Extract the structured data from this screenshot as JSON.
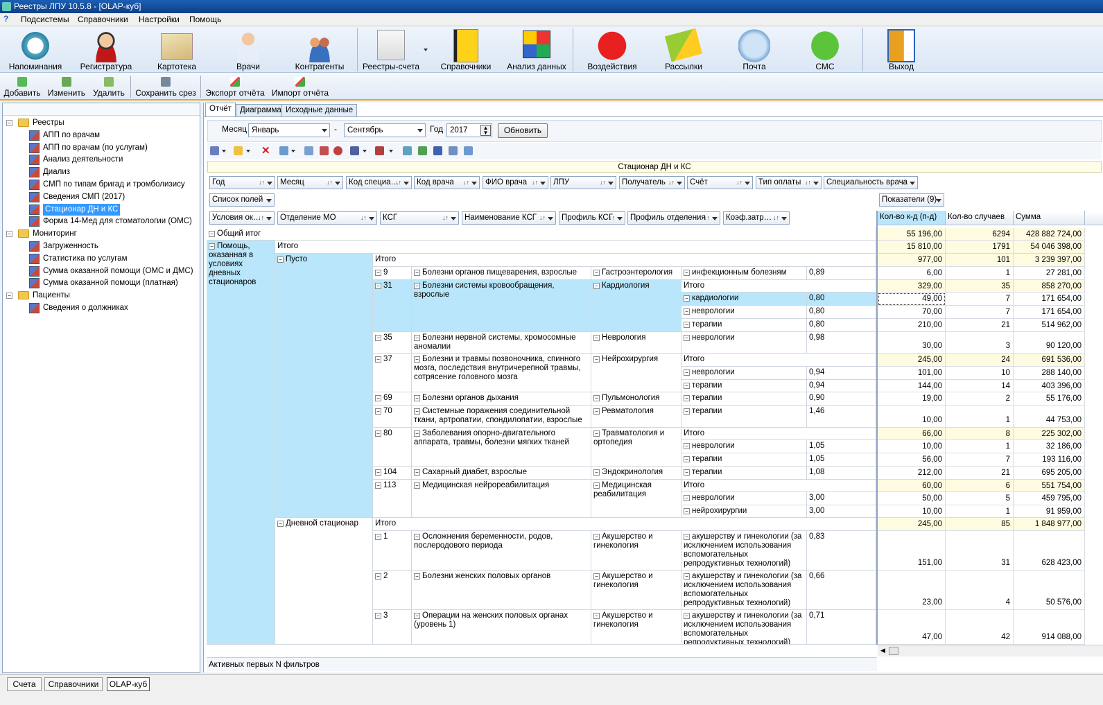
{
  "window": {
    "title": "Реестры ЛПУ 10.5.8 - [OLAP-куб]"
  },
  "menu": [
    "Подсистемы",
    "Справочники",
    "Настройки",
    "Помощь"
  ],
  "ribbon": [
    {
      "label": "Напоминания",
      "icon": "alarm-clock-icon"
    },
    {
      "label": "Регистратура",
      "icon": "receptionist-icon"
    },
    {
      "label": "Картотека",
      "icon": "card-index-icon"
    },
    {
      "label": "Врачи",
      "icon": "doctor-icon"
    },
    {
      "label": "Контрагенты",
      "icon": "people-icon"
    },
    {
      "label": "Реестры-счета",
      "icon": "invoice-icon"
    },
    {
      "label": "Справочники",
      "icon": "book-icon"
    },
    {
      "label": "Анализ данных",
      "icon": "rubik-cube-icon"
    },
    {
      "label": "Воздействия",
      "icon": "sale-tag-icon"
    },
    {
      "label": "Рассылки",
      "icon": "envelopes-icon"
    },
    {
      "label": "Почта",
      "icon": "mail-icon"
    },
    {
      "label": "СМС",
      "icon": "sms-icon"
    },
    {
      "label": "Выход",
      "icon": "exit-door-icon"
    }
  ],
  "toolbar": [
    "Добавить",
    "Изменить",
    "Удалить",
    "Сохранить срез",
    "Экспорт отчёта",
    "Импорт отчёта"
  ],
  "tree": [
    {
      "label": "Реестры",
      "type": "folder"
    },
    {
      "label": "АПП по врачам",
      "type": "cube"
    },
    {
      "label": "АПП по врачам (по услугам)",
      "type": "cube"
    },
    {
      "label": "Анализ деятельности",
      "type": "cube"
    },
    {
      "label": "Диализ",
      "type": "cube"
    },
    {
      "label": "СМП по типам бригад и тромболизису",
      "type": "cube"
    },
    {
      "label": "Сведения СМП (2017)",
      "type": "cube"
    },
    {
      "label": "Стационар ДН и КС",
      "type": "cube",
      "selected": true
    },
    {
      "label": "Форма 14-Мед для стоматологии (ОМС)",
      "type": "cube"
    },
    {
      "label": "Мониторинг",
      "type": "folder"
    },
    {
      "label": "Загруженность",
      "type": "cube"
    },
    {
      "label": "Статистика по услугам",
      "type": "cube"
    },
    {
      "label": "Сумма оказанной помощи (ОМС и ДМС)",
      "type": "cube"
    },
    {
      "label": "Сумма оказанной помощи (платная)",
      "type": "cube"
    },
    {
      "label": "Пациенты",
      "type": "folder"
    },
    {
      "label": "Сведения о должниках",
      "type": "cube"
    }
  ],
  "tabs": [
    "Отчёт",
    "Диаграмма",
    "Исходные данные"
  ],
  "filter": {
    "month_label": "Месяц",
    "month_from": "Январь",
    "dash": "-",
    "month_to": "Сентябрь",
    "year_label": "Год",
    "year": "2017",
    "refresh": "Обновить"
  },
  "report_title": "Стационар ДН и КС",
  "filter_fields": [
    "Год",
    "Месяц",
    "Код специа…",
    "Код врача",
    "ФИО врача",
    "ЛПУ",
    "Получатель",
    "Счёт",
    "Тип оплаты",
    "Специальность врача"
  ],
  "fields_list": "Список полей",
  "row_fields": [
    "Условия ок…",
    "Отделение МО",
    "КСГ",
    "Наименование КСГ",
    "Профиль КСГ",
    "Профиль отделения",
    "Коэф.затр…"
  ],
  "measures_button": "Показатели (9)",
  "measures": [
    "Кол-во к-д (п-д)",
    "Кол-во случаев",
    "Сумма"
  ],
  "grid_text": {
    "grand_total": "Общий итог",
    "cond": "Помощь, оказанная в условиях дневных стационаров",
    "total": "Итого",
    "empty": "Пусто",
    "day_hosp": "Дневной стационар",
    "r9": [
      "9",
      "Болезни органов пищеварения, взрослые",
      "Гастроэнтерология",
      "инфекционным болезням",
      "0,89"
    ],
    "r31": [
      "31",
      "Болезни системы кровообращения, взрослые",
      "Кардиология",
      "кардиологии",
      "0,80",
      "неврологии",
      "0,80",
      "терапии",
      "0,80"
    ],
    "r35": [
      "35",
      "Болезни нервной системы, хромосомные аномалии",
      "Неврология",
      "неврологии",
      "0,98"
    ],
    "r37": [
      "37",
      "Болезни и травмы позвоночника, спинного мозга, последствия внутричерепной травмы, сотрясение головного мозга",
      "Нейрохирургия",
      "неврологии",
      "0,94",
      "терапии",
      "0,94"
    ],
    "r69": [
      "69",
      "Болезни органов дыхания",
      "Пульмонология",
      "терапии",
      "0,90"
    ],
    "r70": [
      "70",
      "Системные поражения соединительной ткани, артропатии, спондилопатии, взрослые",
      "Ревматология",
      "терапии",
      "1,46"
    ],
    "r80": [
      "80",
      "Заболевания опорно-двигательного аппарата, травмы, болезни мягких тканей",
      "Травматология и ортопедия",
      "неврологии",
      "1,05",
      "терапии",
      "1,05"
    ],
    "r104": [
      "104",
      "Сахарный диабет, взрослые",
      "Эндокринология",
      "терапии",
      "1,08"
    ],
    "r113": [
      "113",
      "Медицинская нейрореабилитация",
      "Медицинская реабилитация",
      "неврологии",
      "3,00",
      "нейрохирургии",
      "3,00"
    ],
    "r1": [
      "1",
      "Осложнения беременности, родов, послеродового периода",
      "Акушерство и гинекология",
      "акушерству и гинекологии (за исключением использования вспомогательных репродуктивных технологий)",
      "0,83"
    ],
    "r2": [
      "2",
      "Болезни женских половых органов",
      "Акушерство и гинекология",
      "акушерству и гинекологии (за исключением использования вспомогательных репродуктивных технологий)",
      "0,66"
    ],
    "r3": [
      "3",
      "Операции на женских половых органах (уровень 1)",
      "Акушерство и гинекология",
      "акушерству и гинекологии (за исключением использования вспомогательных репродуктивных технологий)",
      "0,71"
    ]
  },
  "values": [
    [
      "55 196,00",
      "6294",
      "428 882 724,00"
    ],
    [
      "15 810,00",
      "1791",
      "54 046 398,00"
    ],
    [
      "977,00",
      "101",
      "3 239 397,00"
    ],
    [
      "6,00",
      "1",
      "27 281,00"
    ],
    [
      "329,00",
      "35",
      "858 270,00"
    ],
    [
      "49,00",
      "7",
      "171 654,00"
    ],
    [
      "70,00",
      "7",
      "171 654,00"
    ],
    [
      "210,00",
      "21",
      "514 962,00"
    ],
    [
      "30,00",
      "3",
      "90 120,00"
    ],
    [
      "245,00",
      "24",
      "691 536,00"
    ],
    [
      "101,00",
      "10",
      "288 140,00"
    ],
    [
      "144,00",
      "14",
      "403 396,00"
    ],
    [
      "19,00",
      "2",
      "55 176,00"
    ],
    [
      "10,00",
      "1",
      "44 753,00"
    ],
    [
      "66,00",
      "8",
      "225 302,00"
    ],
    [
      "10,00",
      "1",
      "32 186,00"
    ],
    [
      "56,00",
      "7",
      "193 116,00"
    ],
    [
      "212,00",
      "21",
      "695 205,00"
    ],
    [
      "60,00",
      "6",
      "551 754,00"
    ],
    [
      "50,00",
      "5",
      "459 795,00"
    ],
    [
      "10,00",
      "1",
      "91 959,00"
    ],
    [
      "245,00",
      "85",
      "1 848 977,00"
    ],
    [
      "151,00",
      "31",
      "628 423,00"
    ],
    [
      "23,00",
      "4",
      "50 576,00"
    ],
    [
      "47,00",
      "42",
      "914 088,00"
    ]
  ],
  "status_text": "Активных первых N фильтров",
  "bottom_tabs": [
    "Счета",
    "Справочники",
    "OLAP-куб"
  ]
}
